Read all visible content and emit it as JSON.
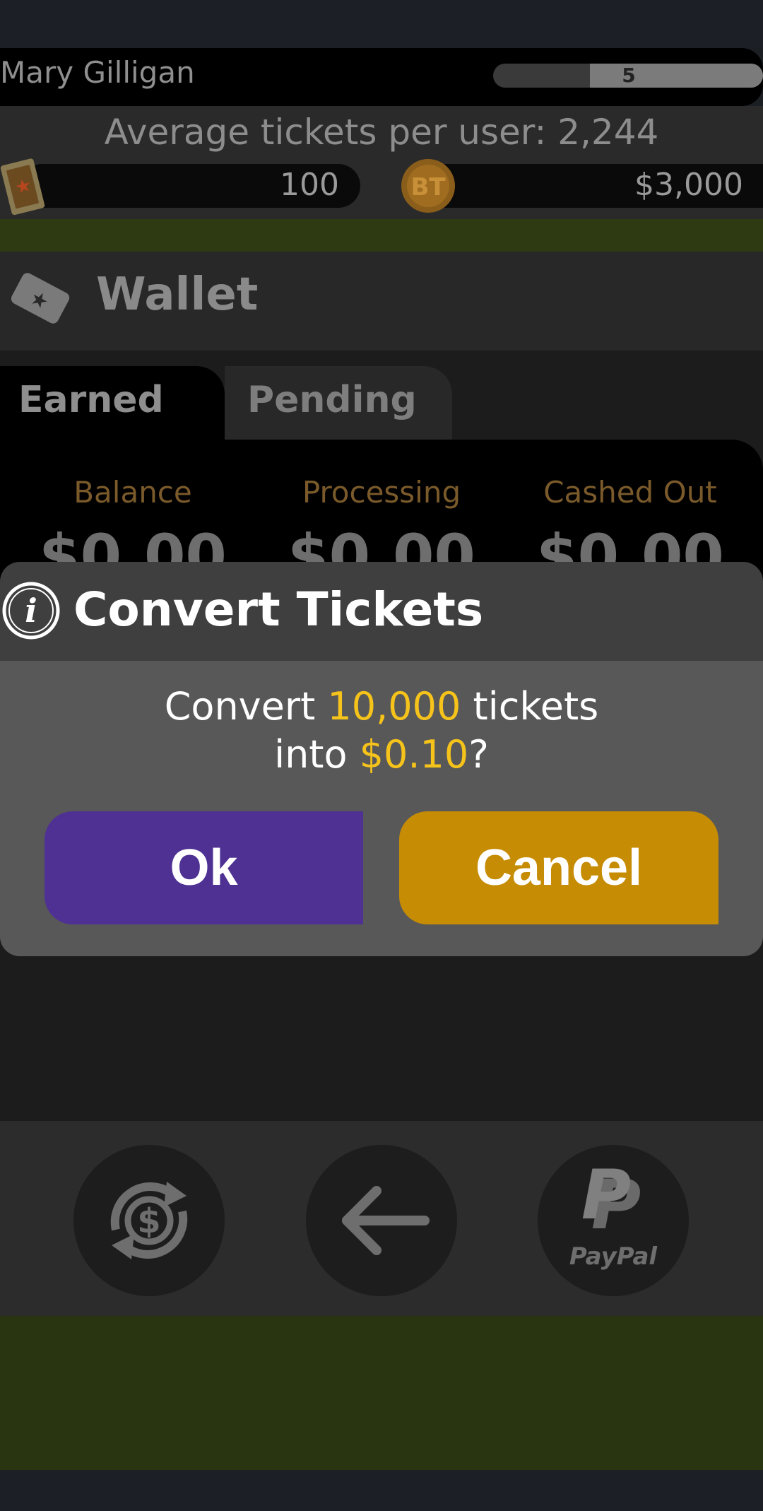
{
  "user": {
    "name": "Mary Gilligan",
    "level": "5"
  },
  "stats_line": "Average tickets per user: 2,244",
  "counters": {
    "tickets": "100",
    "cash": "$3,000",
    "ticket_icon": "ticket-icon",
    "coin_icon": "coin-icon"
  },
  "wallet": {
    "title": "Wallet",
    "icon": "ticket-tag-icon",
    "tabs": [
      {
        "label": "Earned"
      },
      {
        "label": "Pending"
      }
    ],
    "stats": [
      {
        "label": "Balance",
        "value": "$0.00"
      },
      {
        "label": "Processing",
        "value": "$0.00"
      },
      {
        "label": "Cashed Out",
        "value": "$0.00"
      }
    ]
  },
  "dialog": {
    "title": "Convert Tickets",
    "icon": "info-icon",
    "msg_part1": "Convert ",
    "tickets_amount": "10,000",
    "msg_part2": " tickets",
    "msg_part3": "into ",
    "dollar_amount": "$0.10",
    "msg_part4": "?",
    "ok_label": "Ok",
    "cancel_label": "Cancel"
  },
  "actions": [
    {
      "icon": "dollar-exchange-icon"
    },
    {
      "icon": "back-arrow-icon"
    },
    {
      "icon": "paypal-icon",
      "label": "PayPal"
    }
  ],
  "colors": {
    "ok_button": "#4e3193",
    "cancel_button": "#c68c03",
    "highlight": "#f6c31b",
    "stat_label": "#7a5a2a"
  }
}
